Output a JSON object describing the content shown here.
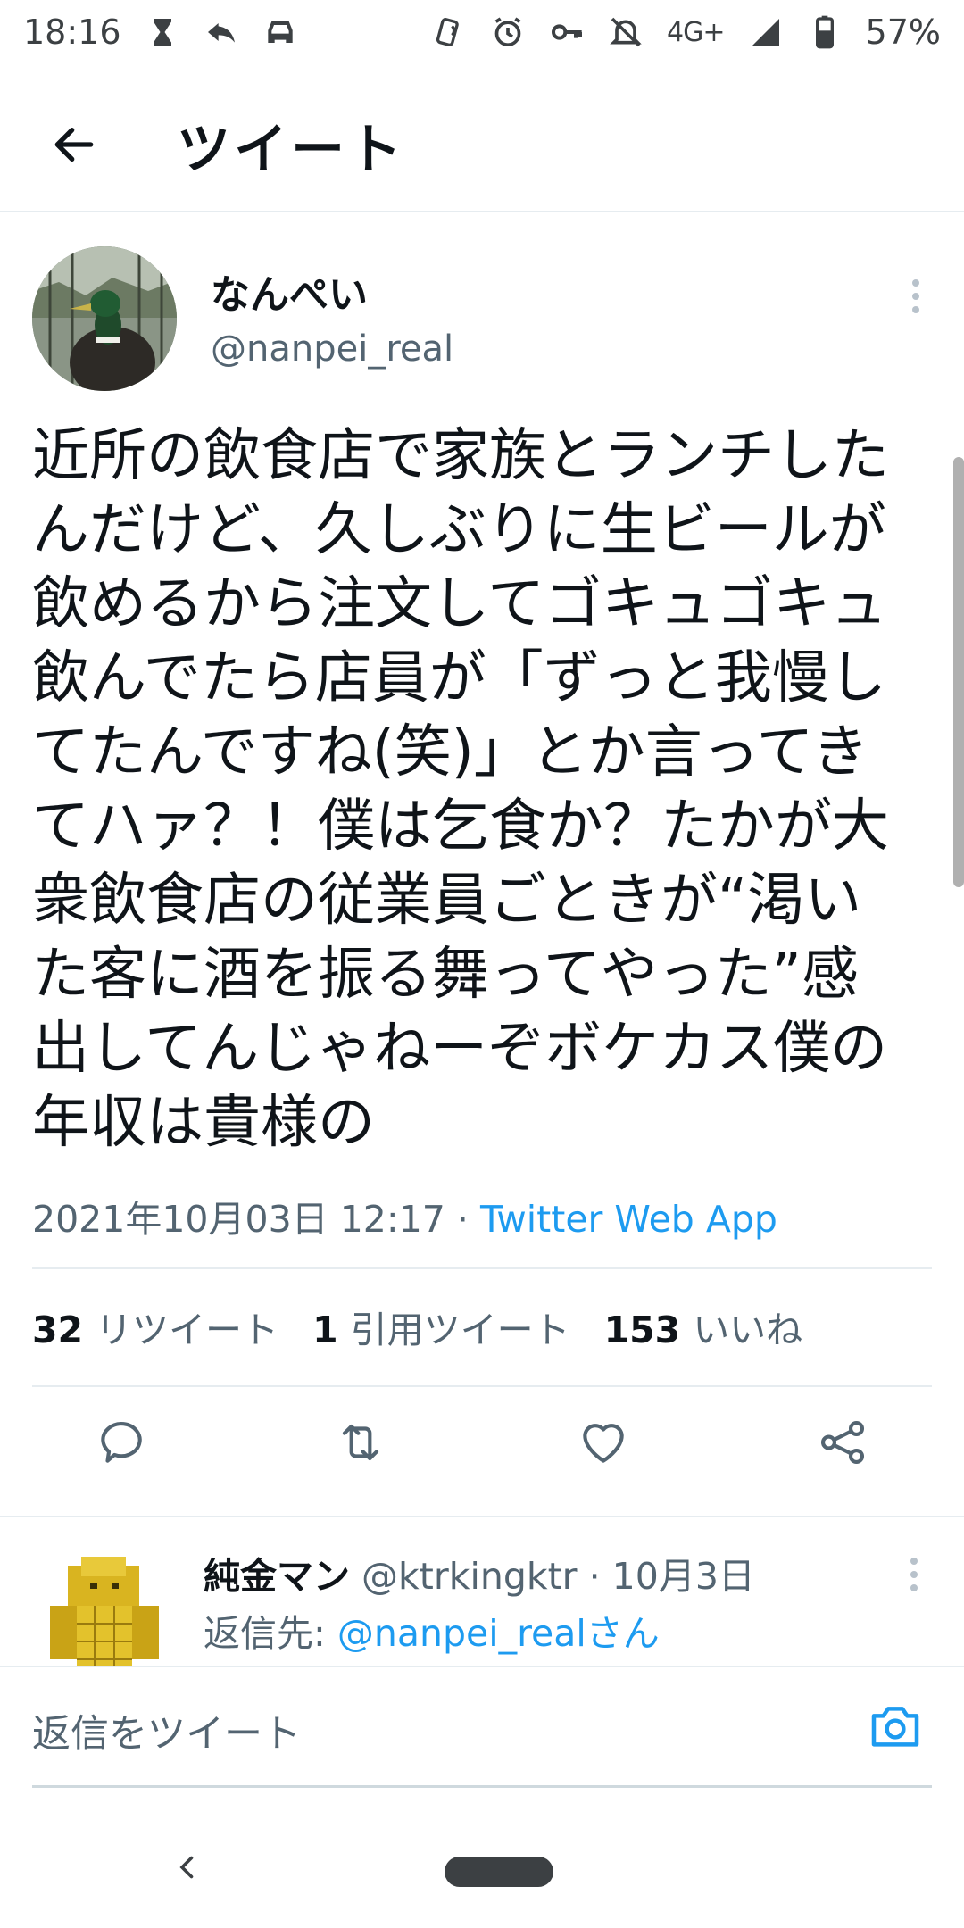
{
  "status_bar": {
    "time": "18:16",
    "network": "4G+",
    "battery": "57%",
    "icons": [
      "hourglass-icon",
      "reply-arrow-icon",
      "car-icon",
      "nfc-icon",
      "alarm-icon",
      "key-icon",
      "bell-off-icon",
      "signal-icon",
      "battery-icon"
    ]
  },
  "header": {
    "title": "ツイート",
    "back_icon": "arrow-left-icon"
  },
  "tweet": {
    "author_name": "なんぺい",
    "author_handle": "@nanpei_real",
    "text": "近所の飲食店で家族とランチした\nんだけど、久しぶりに生ビールが\n飲めるから注文してゴキュゴキュ\n飲んでたら店員が「ずっと我慢し\nてたんですね(笑)」とか言ってき\nてハァ？！僕は乞食か？たかが大\n衆飲食店の従業員ごときが“渇い\nた客に酒を振る舞ってやった”感\n出してんじゃねーぞボケカス僕の\n年収は貴様の",
    "timestamp": "2021年10月03日 12:17",
    "separator": " · ",
    "source": "Twitter Web App"
  },
  "stats": {
    "retweets_count": "32",
    "retweets_label": "リツイート",
    "quotes_count": "1",
    "quotes_label": "引用ツイート",
    "likes_count": "153",
    "likes_label": "いいね"
  },
  "actions": [
    "reply-icon",
    "retweet-icon",
    "like-icon",
    "share-icon"
  ],
  "reply": {
    "name": "純金マン",
    "handle": "@ktrkingktr",
    "date_separator": " · ",
    "date": "10月3日",
    "reply_to_prefix": "返信先: ",
    "reply_to_mention": "@nanpei_realさん"
  },
  "composer": {
    "placeholder": "返信をツイート"
  },
  "colors": {
    "link": "#1d9bf0",
    "secondary_text": "#536471",
    "primary_text": "#0f1419"
  }
}
